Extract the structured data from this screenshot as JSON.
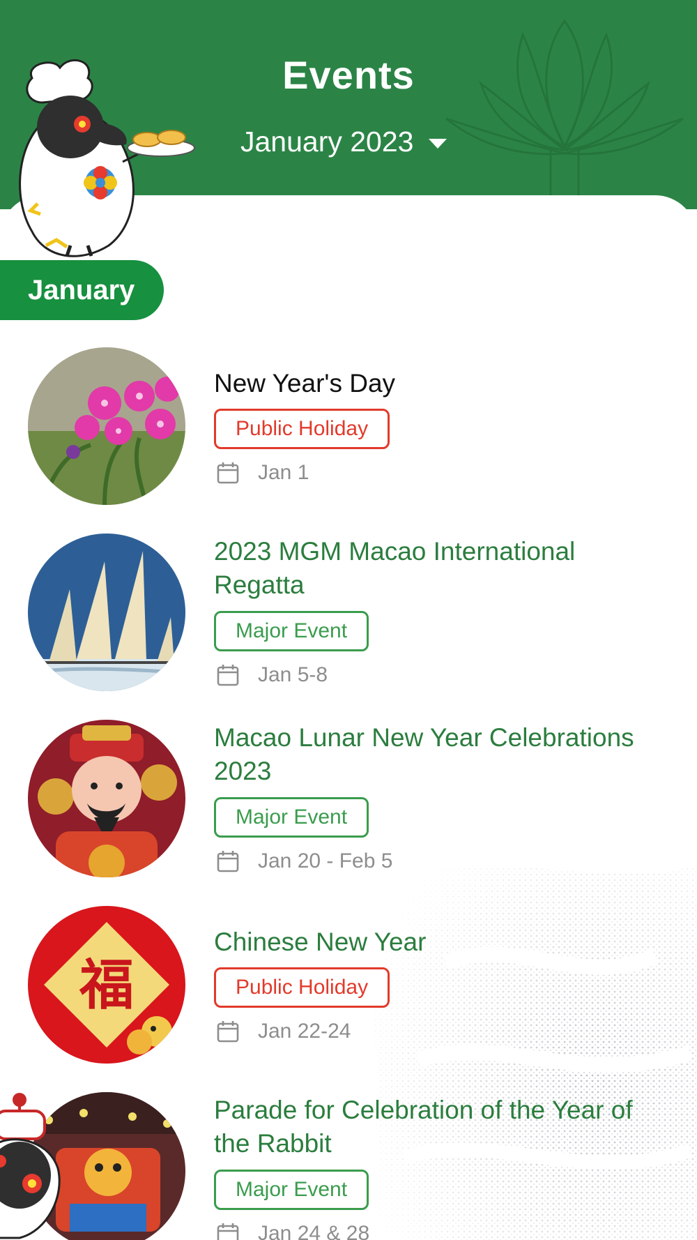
{
  "header": {
    "title": "Events",
    "month_selector": "January 2023",
    "background_color": "#2b8446"
  },
  "section": {
    "month_label": "January"
  },
  "events": [
    {
      "name": "New Year's Day",
      "tag": "Public Holiday",
      "tag_type": "holiday",
      "date": "Jan 1",
      "name_color": "#111111",
      "image": "pink-flowers-photo"
    },
    {
      "name": "2023 MGM Macao International Regatta",
      "tag": "Major Event",
      "tag_type": "major",
      "date": "Jan 5-8",
      "name_color": "#2b7d3e",
      "image": "sailboats-photo"
    },
    {
      "name": "Macao Lunar New Year Celebrations 2023",
      "tag": "Major Event",
      "tag_type": "major",
      "date": "Jan 20 - Feb 5",
      "name_color": "#2b7d3e",
      "image": "god-of-fortune-lantern-photo"
    },
    {
      "name": "Chinese New Year",
      "tag": "Public Holiday",
      "tag_type": "holiday",
      "date": "Jan 22-24",
      "name_color": "#2b7d3e",
      "image": "fu-character-lion-dance-photo"
    },
    {
      "name": "Parade for Celebration of the Year of the Rabbit",
      "tag": "Major Event",
      "tag_type": "major",
      "date": "Jan 24 & 28",
      "name_color": "#2b7d3e",
      "image": "parade-float-photo"
    }
  ],
  "fu_character": "福",
  "icons": [
    "calendar-icon",
    "dropdown-caret-icon",
    "chef-mascot-icon",
    "lotus-watermark-icon"
  ]
}
